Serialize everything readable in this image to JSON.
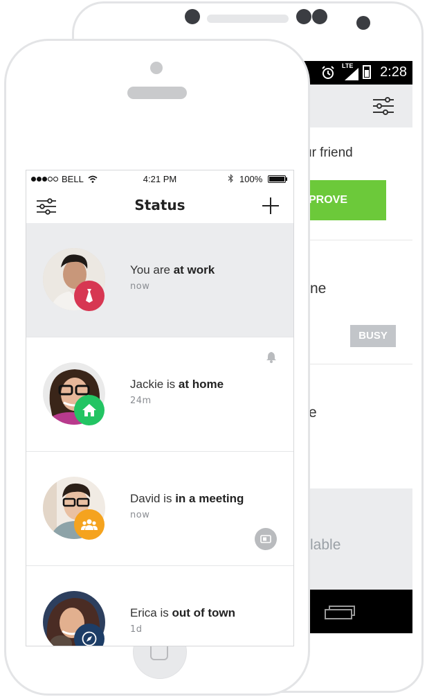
{
  "android": {
    "status": {
      "time": "2:28",
      "network": "LTE"
    },
    "toolbar": {
      "filter_icon": "sliders-icon"
    },
    "rows": [
      {
        "text": "ur friend",
        "button": "PROVE",
        "button_color": "#6cc93a"
      },
      {
        "text": "ne",
        "button": "BUSY",
        "button_color": "#c2c5c9"
      },
      {
        "text": "e"
      },
      {
        "text": "lable"
      }
    ]
  },
  "ios": {
    "status": {
      "carrier": "BELL",
      "time": "4:21 PM",
      "battery": "100%"
    },
    "nav": {
      "title": "Status",
      "filter_icon": "sliders-icon",
      "add_icon": "plus-icon"
    },
    "items": [
      {
        "name": "You are",
        "status": "at work",
        "time": "now",
        "badge_color": "#d73752",
        "badge_icon": "tie-icon",
        "active": true
      },
      {
        "name": "Jackie is",
        "status": "at home",
        "time": "24m",
        "badge_color": "#23c463",
        "badge_icon": "home-icon",
        "extra_icon": "bell-icon"
      },
      {
        "name": "David is",
        "status": "in a meeting",
        "time": "now",
        "badge_color": "#f5a31e",
        "badge_icon": "people-icon",
        "extra_icon": "phone-icon"
      },
      {
        "name": "Erica is",
        "status": "out of town",
        "time": "1d",
        "badge_color": "#1d3d66",
        "badge_icon": "compass-icon"
      }
    ]
  }
}
